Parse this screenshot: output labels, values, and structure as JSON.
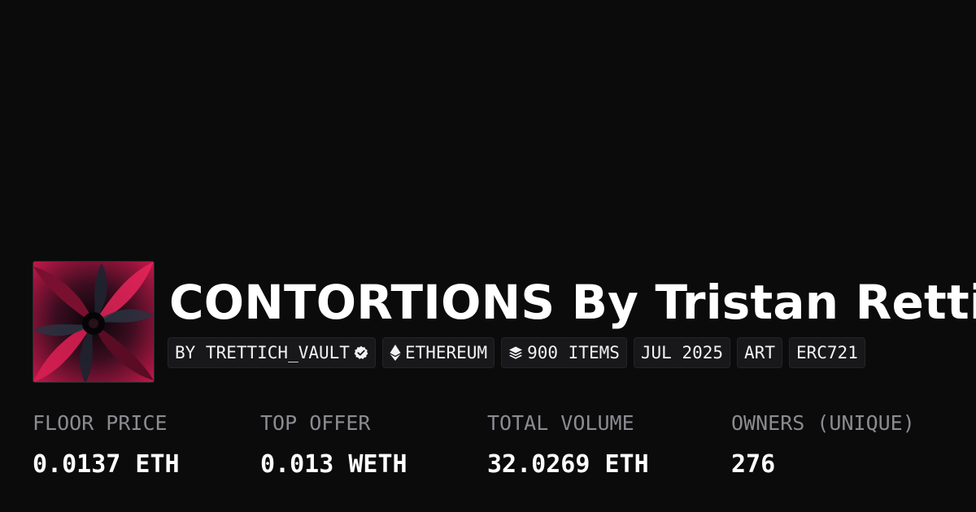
{
  "collection": {
    "title": "CONTORTIONS By Tristan Rettich",
    "thumbnail_icon": "abstract-artwork-thumbnail",
    "accent_color": "#e8245a"
  },
  "tags": {
    "creator": {
      "label": "BY TRETTICH_VAULT",
      "icon": "verified-badge-icon"
    },
    "chain": {
      "label": "ETHEREUM",
      "icon": "ethereum-icon"
    },
    "items": {
      "label": "900 ITEMS",
      "icon": "layers-icon"
    },
    "date": {
      "label": "JUL 2025"
    },
    "category": {
      "label": "ART"
    },
    "standard": {
      "label": "ERC721"
    }
  },
  "stats": [
    {
      "label": "FLOOR PRICE",
      "value": "0.0137 ETH"
    },
    {
      "label": "TOP OFFER",
      "value": "0.013 WETH"
    },
    {
      "label": "TOTAL VOLUME",
      "value": "32.0269 ETH"
    },
    {
      "label": "OWNERS (UNIQUE)",
      "value": "276"
    }
  ]
}
